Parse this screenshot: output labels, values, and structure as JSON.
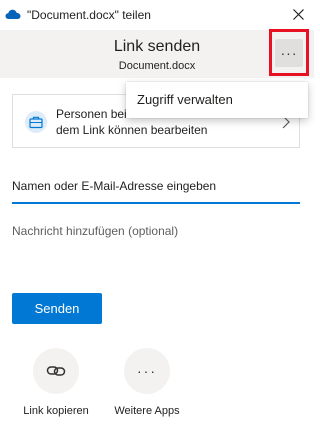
{
  "window": {
    "title": "\"Document.docx\" teilen",
    "close_glyph": "✕",
    "icon": "onedrive-cloud-icon"
  },
  "header": {
    "title": "Link senden",
    "subtitle": "Document.docx",
    "more_label": "···"
  },
  "menu": {
    "items": [
      {
        "label": "Zugriff verwalten"
      }
    ]
  },
  "permission": {
    "text": "Personen bei ... können mit dem Link können bearbeiten",
    "visible_line1": "Personen bei",
    "visible_line2": "dem Link können bearbeiten",
    "icon": "briefcase-icon"
  },
  "email": {
    "placeholder": "Namen oder E-Mail-Adresse eingeben"
  },
  "message": {
    "placeholder": "Nachricht hinzufügen (optional)"
  },
  "send": {
    "label": "Senden"
  },
  "actions": [
    {
      "label": "Link kopieren",
      "icon": "link-icon"
    },
    {
      "label": "Weitere Apps",
      "icon": "more-horizontal-icon",
      "glyph": "···"
    }
  ],
  "colors": {
    "accent": "#0078d4",
    "highlight": "#e81123",
    "header_bg": "#f3f2f1"
  }
}
